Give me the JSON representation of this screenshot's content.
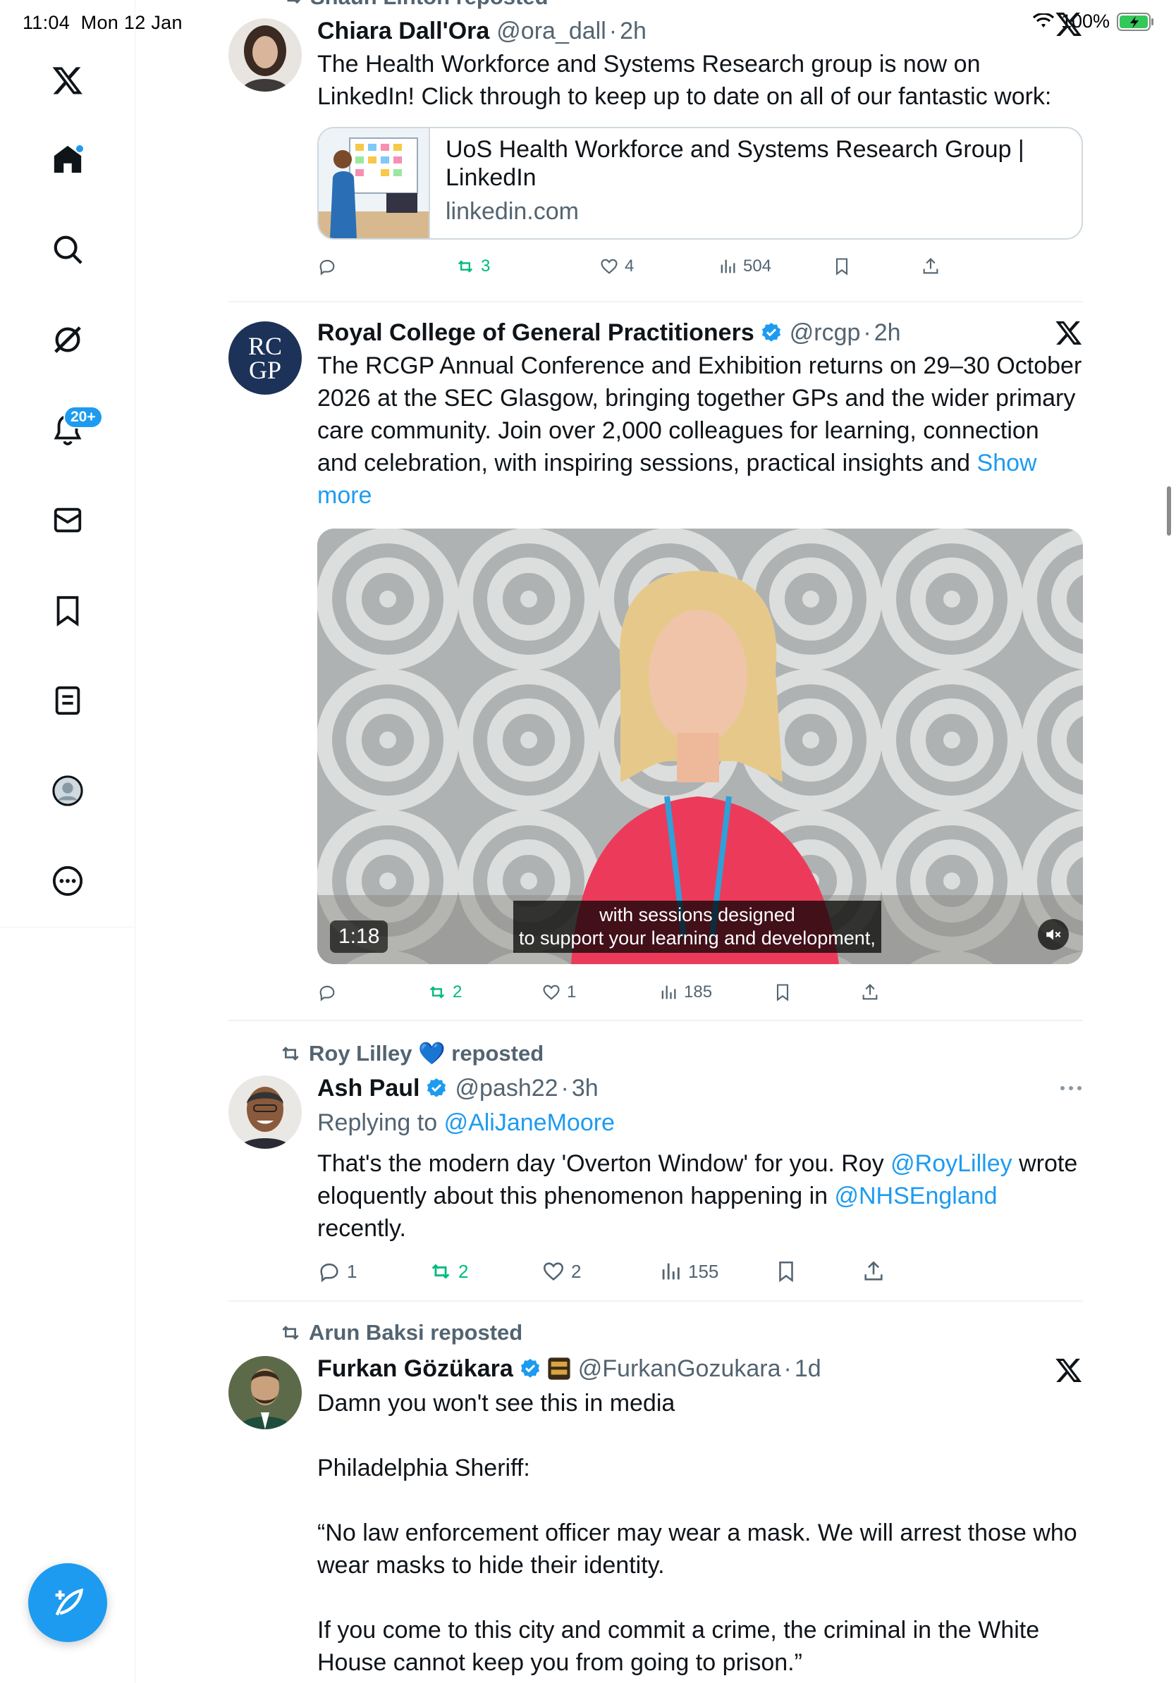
{
  "status_bar": {
    "time": "11:04",
    "date": "Mon 12 Jan",
    "battery": "100%"
  },
  "sidebar": {
    "items": [
      {
        "icon": "x-logo-icon"
      },
      {
        "icon": "home-icon"
      },
      {
        "icon": "search-icon"
      },
      {
        "icon": "grok-icon"
      },
      {
        "icon": "notifications-icon",
        "badge": "20+"
      },
      {
        "icon": "messages-icon"
      },
      {
        "icon": "bookmarks-icon"
      },
      {
        "icon": "lists-icon"
      },
      {
        "icon": "profile-icon"
      },
      {
        "icon": "more-icon"
      }
    ]
  },
  "posts": [
    {
      "author": "Chiara Dall'Ora",
      "handle": "@ora_dall",
      "time": "2h",
      "text": "The Health Workforce and Systems Research group is now on LinkedIn! Click through to keep up to date on all of our fantastic work:",
      "card": {
        "title": "UoS Health Workforce and Systems Research Group | LinkedIn",
        "domain": "linkedin.com"
      },
      "stats": {
        "reposts": "3",
        "likes": "4",
        "views": "504"
      }
    },
    {
      "author": "Royal College of General Practitioners",
      "handle": "@rcgp",
      "time": "2h",
      "avatar_text": "RC GP",
      "text": "The RCGP Annual Conference and Exhibition returns on 29–30 October 2026 at the SEC Glasgow, bringing together GPs and the wider primary care community. Join over 2,000 colleagues for learning, connection and celebration, with inspiring sessions, practical insights and",
      "show_more": "Show more",
      "video": {
        "duration": "1:18",
        "caption_line1": "with sessions designed",
        "caption_line2": "to support your learning and development,"
      },
      "stats": {
        "reposts": "2",
        "likes": "1",
        "views": "185"
      }
    },
    {
      "reposted_by": "Roy Lilley 💙 reposted",
      "author": "Ash Paul",
      "handle": "@pash22",
      "time": "3h",
      "replying_prefix": "Replying to",
      "replying_to": "@AliJaneMoore",
      "text_1": "That's the modern day 'Overton Window' for you. Roy",
      "mention_1": "@RoyLilley",
      "text_2": "wrote eloquently about this phenomenon happening in",
      "mention_2": "@NHSEngland",
      "text_3": "recently.",
      "stats": {
        "replies": "1",
        "reposts": "2",
        "likes": "2",
        "views": "155"
      }
    },
    {
      "reposted_by": "Arun Baksi reposted",
      "author": "Furkan Gözükara",
      "handle": "@FurkanGozukara",
      "time": "1d",
      "para_1": "Damn you won't see this in media",
      "para_2": "Philadelphia Sheriff:",
      "para_3": "“No law enforcement officer may wear a mask. We will arrest those who wear masks to hide their identity.",
      "para_4": "If you come to this city and commit a crime, the criminal in the White House cannot keep you from going to prison.”"
    }
  ],
  "partial_top_repost": "Shaun Linton reposted",
  "colors": {
    "accent": "#1d9bf0",
    "repost": "#00ba7c",
    "muted": "#536471"
  }
}
